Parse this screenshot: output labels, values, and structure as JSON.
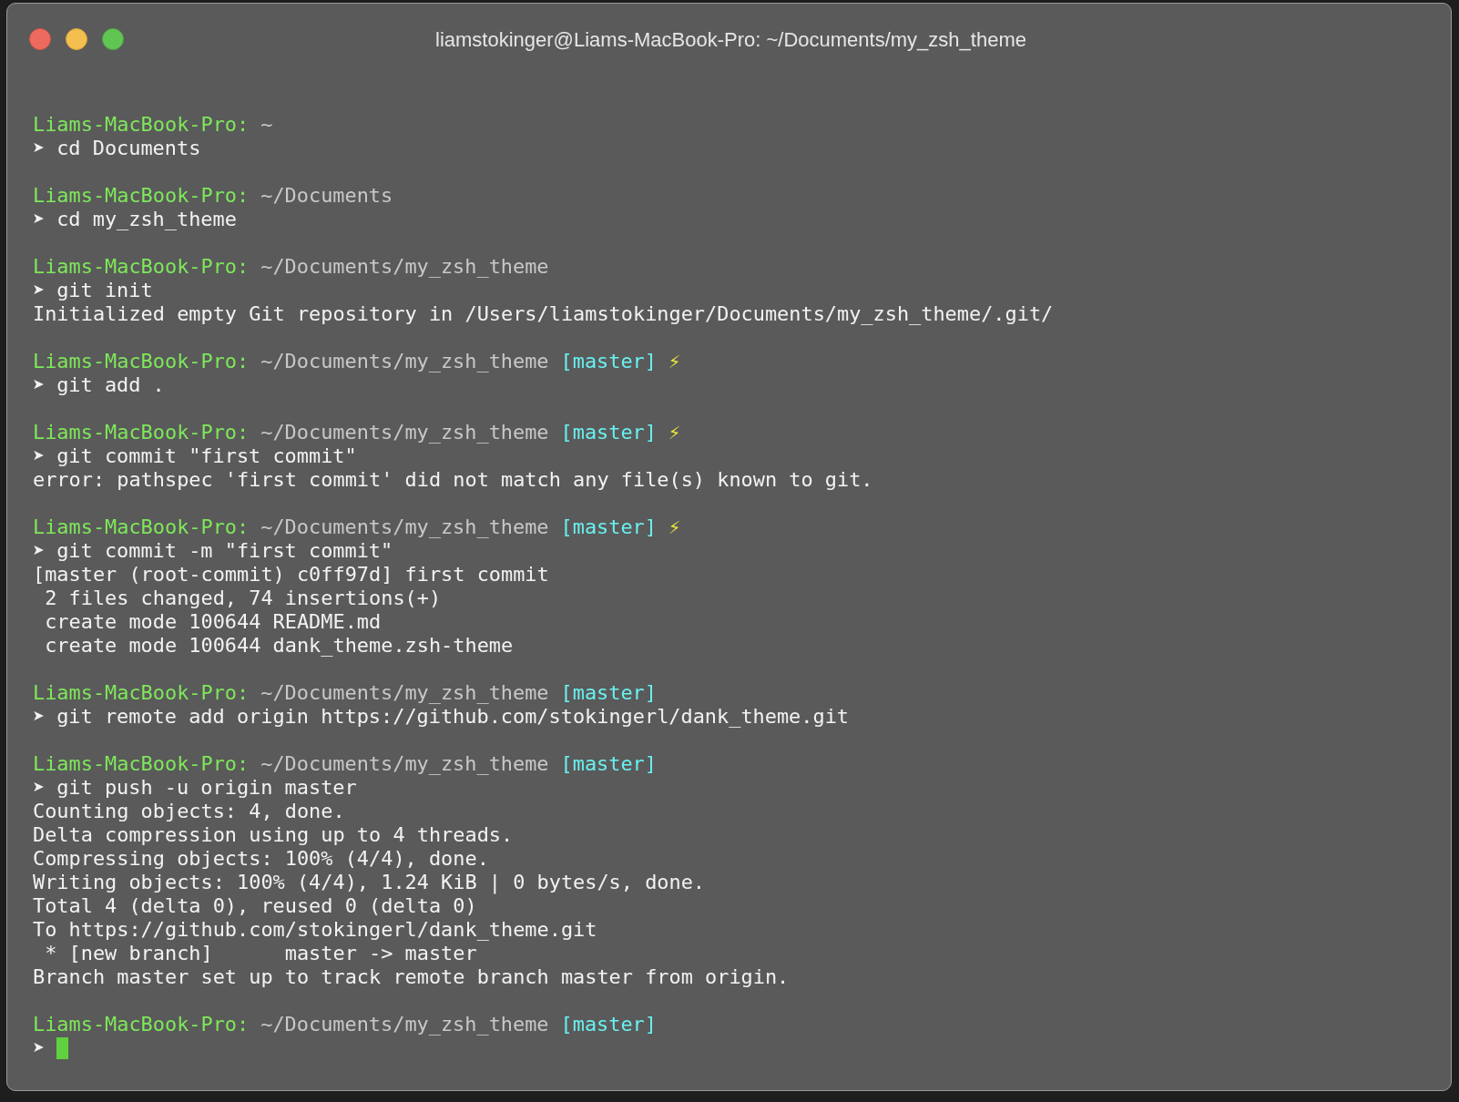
{
  "window": {
    "title": "liamstokinger@Liams-MacBook-Pro: ~/Documents/my_zsh_theme"
  },
  "terminal": {
    "blocks": [
      {
        "host": "Liams-MacBook-Pro:",
        "path": "~",
        "arrow": "➤",
        "command": "cd Documents"
      },
      {
        "host": "Liams-MacBook-Pro:",
        "path": "~/Documents",
        "arrow": "➤",
        "command": "cd my_zsh_theme"
      },
      {
        "host": "Liams-MacBook-Pro:",
        "path": "~/Documents/my_zsh_theme",
        "arrow": "➤",
        "command": "git init",
        "output": [
          "Initialized empty Git repository in /Users/liamstokinger/Documents/my_zsh_theme/.git/"
        ]
      },
      {
        "host": "Liams-MacBook-Pro:",
        "path": "~/Documents/my_zsh_theme",
        "branch": "[master]",
        "dirty_mark": "⚡",
        "arrow": "➤",
        "command": "git add ."
      },
      {
        "host": "Liams-MacBook-Pro:",
        "path": "~/Documents/my_zsh_theme",
        "branch": "[master]",
        "dirty_mark": "⚡",
        "arrow": "➤",
        "command": "git commit \"first commit\"",
        "output": [
          "error: pathspec 'first commit' did not match any file(s) known to git."
        ]
      },
      {
        "host": "Liams-MacBook-Pro:",
        "path": "~/Documents/my_zsh_theme",
        "branch": "[master]",
        "dirty_mark": "⚡",
        "arrow": "➤",
        "command": "git commit -m \"first commit\"",
        "output": [
          "[master (root-commit) c0ff97d] first commit",
          " 2 files changed, 74 insertions(+)",
          " create mode 100644 README.md",
          " create mode 100644 dank_theme.zsh-theme"
        ]
      },
      {
        "host": "Liams-MacBook-Pro:",
        "path": "~/Documents/my_zsh_theme",
        "branch": "[master]",
        "arrow": "➤",
        "command": "git remote add origin https://github.com/stokingerl/dank_theme.git"
      },
      {
        "host": "Liams-MacBook-Pro:",
        "path": "~/Documents/my_zsh_theme",
        "branch": "[master]",
        "arrow": "➤",
        "command": "git push -u origin master",
        "output": [
          "Counting objects: 4, done.",
          "Delta compression using up to 4 threads.",
          "Compressing objects: 100% (4/4), done.",
          "Writing objects: 100% (4/4), 1.24 KiB | 0 bytes/s, done.",
          "Total 4 (delta 0), reused 0 (delta 0)",
          "To https://github.com/stokingerl/dank_theme.git",
          " * [new branch]      master -> master",
          "Branch master set up to track remote branch master from origin."
        ]
      },
      {
        "host": "Liams-MacBook-Pro:",
        "path": "~/Documents/my_zsh_theme",
        "branch": "[master]",
        "arrow": "➤",
        "cursor": true
      }
    ]
  }
}
